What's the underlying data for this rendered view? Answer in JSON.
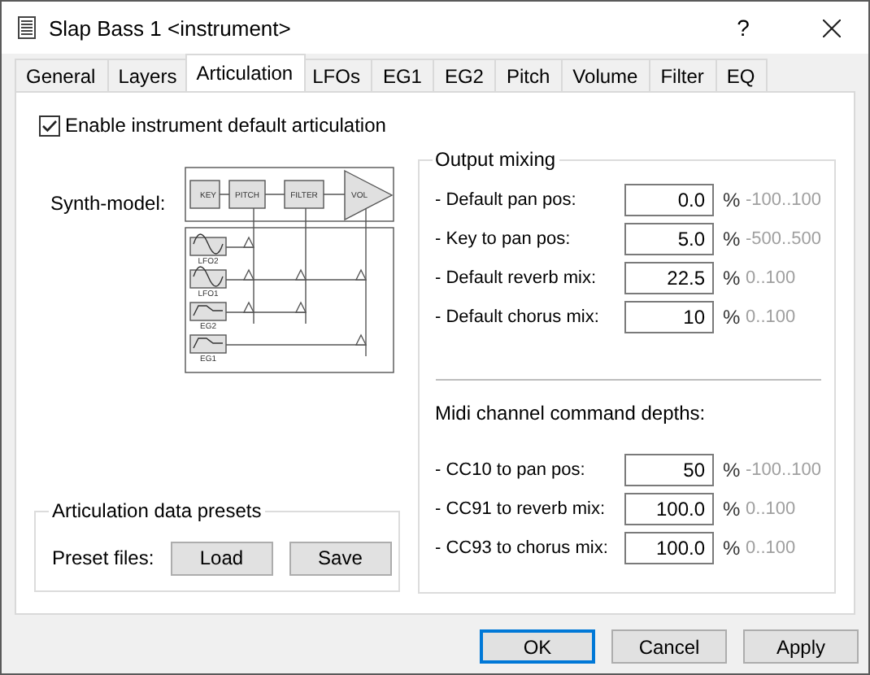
{
  "window": {
    "title": "Slap Bass 1 <instrument>",
    "help": "?"
  },
  "tabs": [
    {
      "label": "General",
      "selected": false
    },
    {
      "label": "Layers",
      "selected": false
    },
    {
      "label": "Articulation",
      "selected": true
    },
    {
      "label": "LFOs",
      "selected": false
    },
    {
      "label": "EG1",
      "selected": false
    },
    {
      "label": "EG2",
      "selected": false
    },
    {
      "label": "Pitch",
      "selected": false
    },
    {
      "label": "Volume",
      "selected": false
    },
    {
      "label": "Filter",
      "selected": false
    },
    {
      "label": "EQ",
      "selected": false
    }
  ],
  "enable_default_articulation": {
    "label": "Enable instrument default articulation",
    "checked": true
  },
  "synth_model": {
    "label": "Synth-model:",
    "blocks": [
      "KEY",
      "PITCH",
      "FILTER",
      "VOL"
    ],
    "sources": [
      "LFO2",
      "LFO1",
      "EG2",
      "EG1"
    ]
  },
  "presets": {
    "title": "Articulation data presets",
    "label": "Preset files:",
    "buttons": [
      "Load",
      "Save"
    ]
  },
  "output_mixing": {
    "title": "Output mixing",
    "rows": [
      {
        "label": "- Default pan pos:",
        "value": "0.0",
        "unit": "%",
        "range": "-100..100"
      },
      {
        "label": "- Key to pan pos:",
        "value": "5.0",
        "unit": "%",
        "range": "-500..500"
      },
      {
        "label": "- Default reverb mix:",
        "value": "22.5",
        "unit": "%",
        "range": "0..100"
      },
      {
        "label": "- Default chorus mix:",
        "value": "10",
        "unit": "%",
        "range": "0..100"
      }
    ]
  },
  "midi_depths": {
    "title": "Midi channel command depths:",
    "rows": [
      {
        "label": "- CC10 to pan pos:",
        "value": "50",
        "unit": "%",
        "range": "-100..100"
      },
      {
        "label": "- CC91 to reverb mix:",
        "value": "100.0",
        "unit": "%",
        "range": "0..100"
      },
      {
        "label": "- CC93 to chorus mix:",
        "value": "100.0",
        "unit": "%",
        "range": "0..100"
      }
    ]
  },
  "buttons": [
    {
      "label": "OK",
      "default": true
    },
    {
      "label": "Cancel",
      "default": false
    },
    {
      "label": "Apply",
      "default": false
    }
  ]
}
